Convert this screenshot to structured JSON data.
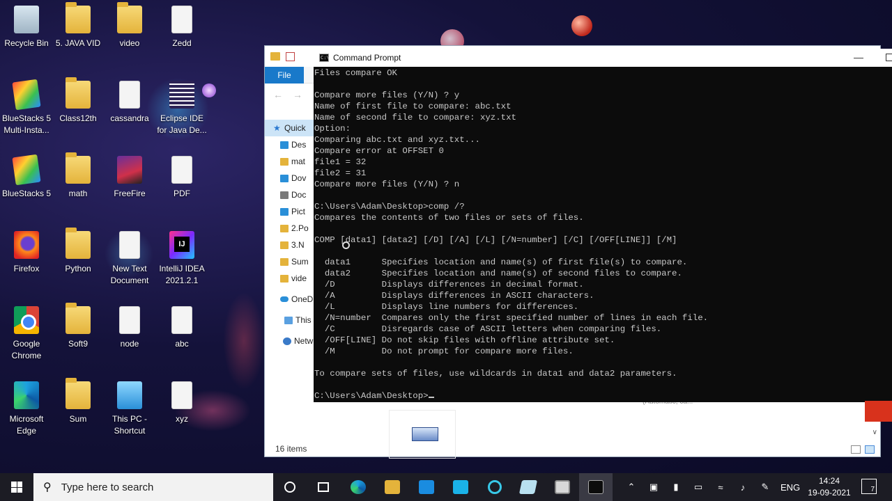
{
  "desktop_icons": [
    {
      "label": "Recycle Bin",
      "icon": "recycle-bin-icon"
    },
    {
      "label": "5. JAVA VID",
      "icon": "folder-icon"
    },
    {
      "label": "video",
      "icon": "folder-icon"
    },
    {
      "label": "Zedd",
      "icon": "document-icon"
    },
    {
      "label": "BlueStacks 5 Multi-Insta...",
      "icon": "bluestacks-multi-icon"
    },
    {
      "label": "Class12th",
      "icon": "folder-icon"
    },
    {
      "label": "cassandra",
      "icon": "document-icon"
    },
    {
      "label": "Eclipse IDE for Java De...",
      "icon": "eclipse-icon"
    },
    {
      "label": "BlueStacks 5",
      "icon": "bluestacks-icon"
    },
    {
      "label": "math",
      "icon": "folder-icon"
    },
    {
      "label": "FreeFire",
      "icon": "freefire-icon"
    },
    {
      "label": "PDF",
      "icon": "document-icon"
    },
    {
      "label": "Firefox",
      "icon": "firefox-icon"
    },
    {
      "label": "Python",
      "icon": "folder-icon"
    },
    {
      "label": "New Text Document",
      "icon": "document-icon"
    },
    {
      "label": "IntelliJ IDEA 2021.2.1",
      "icon": "intellij-icon"
    },
    {
      "label": "Google Chrome",
      "icon": "chrome-icon"
    },
    {
      "label": "Soft9",
      "icon": "folder-icon"
    },
    {
      "label": "node",
      "icon": "document-icon"
    },
    {
      "label": "abc",
      "icon": "document-icon"
    },
    {
      "label": "Microsoft Edge",
      "icon": "edge-icon"
    },
    {
      "label": "Sum",
      "icon": "folder-icon"
    },
    {
      "label": "This PC - Shortcut",
      "icon": "this-pc-icon"
    },
    {
      "label": "xyz",
      "icon": "document-icon"
    }
  ],
  "explorer": {
    "ribbon_file": "File",
    "nav_items": [
      {
        "label": "Quick",
        "icon": "star-icon"
      },
      {
        "label": "Des",
        "icon": "desktop-icon"
      },
      {
        "label": "mat",
        "icon": "folder-icon"
      },
      {
        "label": "Dov",
        "icon": "download-icon"
      },
      {
        "label": "Doc",
        "icon": "documents-icon"
      },
      {
        "label": "Pict",
        "icon": "pictures-icon"
      },
      {
        "label": "2.Po",
        "icon": "folder-icon"
      },
      {
        "label": "3.N",
        "icon": "folder-icon"
      },
      {
        "label": "Sum",
        "icon": "folder-icon"
      },
      {
        "label": "vide",
        "icon": "folder-icon"
      },
      {
        "label": "OneD",
        "icon": "onedrive-icon"
      },
      {
        "label": "This P",
        "icon": "this-pc-icon"
      },
      {
        "label": "Netw",
        "icon": "network-icon"
      }
    ],
    "status": "16 items",
    "faint_text": "(Automatic, ca..."
  },
  "cmd": {
    "title": "Command Prompt",
    "lines": [
      "Files compare OK",
      "",
      "Compare more files (Y/N) ? y",
      "Name of first file to compare: abc.txt",
      "Name of second file to compare: xyz.txt",
      "Option:",
      "Comparing abc.txt and xyz.txt...",
      "Compare error at OFFSET 0",
      "file1 = 32",
      "file2 = 31",
      "Compare more files (Y/N) ? n",
      "",
      "C:\\Users\\Adam\\Desktop>comp /?",
      "Compares the contents of two files or sets of files.",
      "",
      "COMP [data1] [data2] [/D] [/A] [/L] [/N=number] [/C] [/OFF[LINE]] [/M]",
      "",
      "  data1      Specifies location and name(s) of first file(s) to compare.",
      "  data2      Specifies location and name(s) of second files to compare.",
      "  /D         Displays differences in decimal format.",
      "  /A         Displays differences in ASCII characters.",
      "  /L         Displays line numbers for differences.",
      "  /N=number  Compares only the first specified number of lines in each file.",
      "  /C         Disregards case of ASCII letters when comparing files.",
      "  /OFF[LINE] Do not skip files with offline attribute set.",
      "  /M         Do not prompt for compare more files.",
      "",
      "To compare sets of files, use wildcards in data1 and data2 parameters.",
      "",
      "C:\\Users\\Adam\\Desktop>"
    ]
  },
  "taskbar": {
    "search_placeholder": "Type here to search",
    "language": "ENG",
    "time": "14:24",
    "date": "19-09-2021",
    "notification_count": "7"
  }
}
